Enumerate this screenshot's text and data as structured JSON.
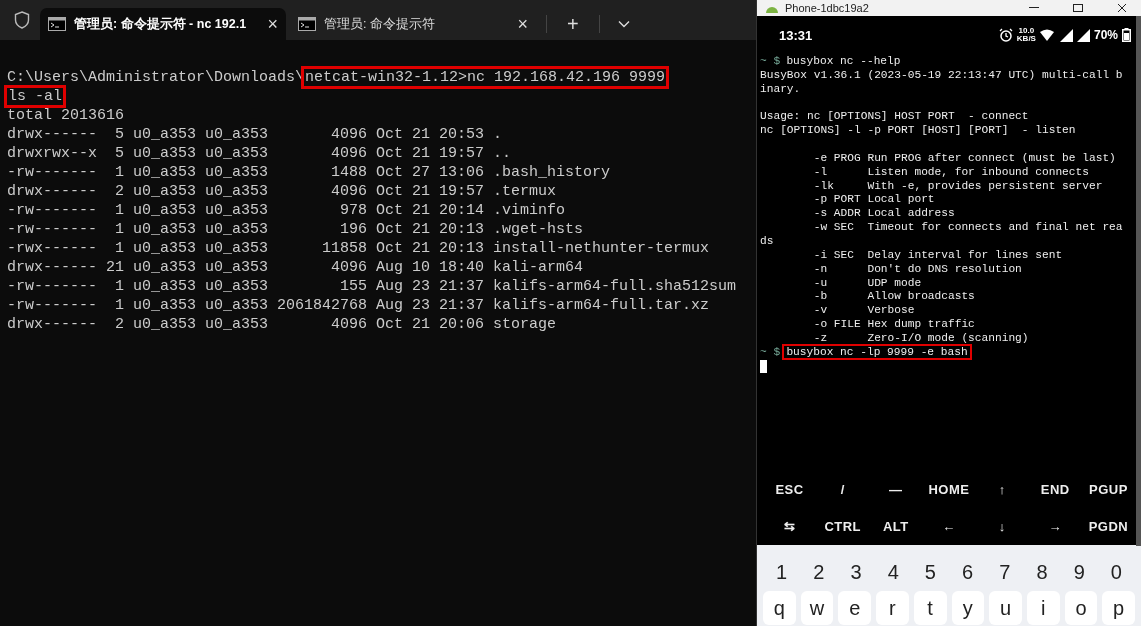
{
  "terminal": {
    "tabs": [
      {
        "title": "管理员: 命令提示符 - nc  192.1",
        "close": "×",
        "selected": true
      },
      {
        "title": "管理员: 命令提示符",
        "close": "×",
        "selected": false
      }
    ],
    "new_tab": "+",
    "lines": [
      {
        "segments": [
          {
            "text": "C:\\Users\\Administrator\\Downloads\\",
            "boxed": false
          },
          {
            "text": "netcat-win32-1.12>nc 192.168.42.196 9999",
            "boxed": true
          }
        ]
      },
      {
        "segments": [
          {
            "text": "ls -al",
            "boxed": true
          }
        ]
      },
      {
        "segments": [
          {
            "text": "total 2013616",
            "boxed": false
          }
        ]
      },
      {
        "segments": [
          {
            "text": "drwx------  5 u0_a353 u0_a353       4096 Oct 21 20:53 .",
            "boxed": false
          }
        ]
      },
      {
        "segments": [
          {
            "text": "drwxrwx--x  5 u0_a353 u0_a353       4096 Oct 21 19:57 ..",
            "boxed": false
          }
        ]
      },
      {
        "segments": [
          {
            "text": "-rw-------  1 u0_a353 u0_a353       1488 Oct 27 13:06 .bash_history",
            "boxed": false
          }
        ]
      },
      {
        "segments": [
          {
            "text": "drwx------  2 u0_a353 u0_a353       4096 Oct 21 19:57 .termux",
            "boxed": false
          }
        ]
      },
      {
        "segments": [
          {
            "text": "-rw-------  1 u0_a353 u0_a353        978 Oct 21 20:14 .viminfo",
            "boxed": false
          }
        ]
      },
      {
        "segments": [
          {
            "text": "-rw-------  1 u0_a353 u0_a353        196 Oct 21 20:13 .wget-hsts",
            "boxed": false
          }
        ]
      },
      {
        "segments": [
          {
            "text": "-rwx------  1 u0_a353 u0_a353      11858 Oct 21 20:13 install-nethunter-termux",
            "boxed": false
          }
        ]
      },
      {
        "segments": [
          {
            "text": "drwx------ 21 u0_a353 u0_a353       4096 Aug 10 18:40 kali-arm64",
            "boxed": false
          }
        ]
      },
      {
        "segments": [
          {
            "text": "-rw-------  1 u0_a353 u0_a353        155 Aug 23 21:37 kalifs-arm64-full.sha512sum",
            "boxed": false
          }
        ]
      },
      {
        "segments": [
          {
            "text": "-rw-------  1 u0_a353 u0_a353 2061842768 Aug 23 21:37 kalifs-arm64-full.tar.xz",
            "boxed": false
          }
        ]
      },
      {
        "segments": [
          {
            "text": "drwx------  2 u0_a353 u0_a353       4096 Oct 21 20:06 storage",
            "boxed": false
          }
        ]
      }
    ]
  },
  "phone": {
    "title": "Phone-1dbc19a2",
    "status_bar": {
      "time": "13:31",
      "net_speed": "10.0",
      "net_unit": "KB/S",
      "battery": "70%"
    },
    "lines": [
      {
        "kind": "prompt",
        "prompt": "~ $",
        "command": "busybox nc --help",
        "boxed": false
      },
      {
        "kind": "text",
        "text": "BusyBox v1.36.1 (2023-05-19 22:13:47 UTC) multi-call b"
      },
      {
        "kind": "text",
        "text": "inary."
      },
      {
        "kind": "blank"
      },
      {
        "kind": "text",
        "text": "Usage: nc [OPTIONS] HOST PORT  - connect"
      },
      {
        "kind": "text",
        "text": "nc [OPTIONS] -l -p PORT [HOST] [PORT]  - listen"
      },
      {
        "kind": "blank"
      },
      {
        "kind": "text",
        "text": "        -e PROG Run PROG after connect (must be last)"
      },
      {
        "kind": "text",
        "text": "        -l      Listen mode, for inbound connects"
      },
      {
        "kind": "text",
        "text": "        -lk     With -e, provides persistent server"
      },
      {
        "kind": "text",
        "text": "        -p PORT Local port"
      },
      {
        "kind": "text",
        "text": "        -s ADDR Local address"
      },
      {
        "kind": "text",
        "text": "        -w SEC  Timeout for connects and final net rea"
      },
      {
        "kind": "text",
        "text": "ds"
      },
      {
        "kind": "text",
        "text": "        -i SEC  Delay interval for lines sent"
      },
      {
        "kind": "text",
        "text": "        -n      Don't do DNS resolution"
      },
      {
        "kind": "text",
        "text": "        -u      UDP mode"
      },
      {
        "kind": "text",
        "text": "        -b      Allow broadcasts"
      },
      {
        "kind": "text",
        "text": "        -v      Verbose"
      },
      {
        "kind": "text",
        "text": "        -o FILE Hex dump traffic"
      },
      {
        "kind": "text",
        "text": "        -z      Zero-I/O mode (scanning)"
      },
      {
        "kind": "prompt",
        "prompt": "~ $",
        "command": "busybox nc -lp 9999 -e bash",
        "boxed": true
      },
      {
        "kind": "cursor"
      }
    ],
    "extra_keys": [
      [
        "ESC",
        "/",
        "—",
        "HOME",
        "↑",
        "END",
        "PGUP"
      ],
      [
        "⇆",
        "CTRL",
        "ALT",
        "←",
        "↓",
        "→",
        "PGDN"
      ]
    ],
    "keyboard": [
      [
        "1",
        "2",
        "3",
        "4",
        "5",
        "6",
        "7",
        "8",
        "9",
        "0"
      ],
      [
        "q",
        "w",
        "e",
        "r",
        "t",
        "y",
        "u",
        "i",
        "o",
        "p"
      ]
    ]
  }
}
